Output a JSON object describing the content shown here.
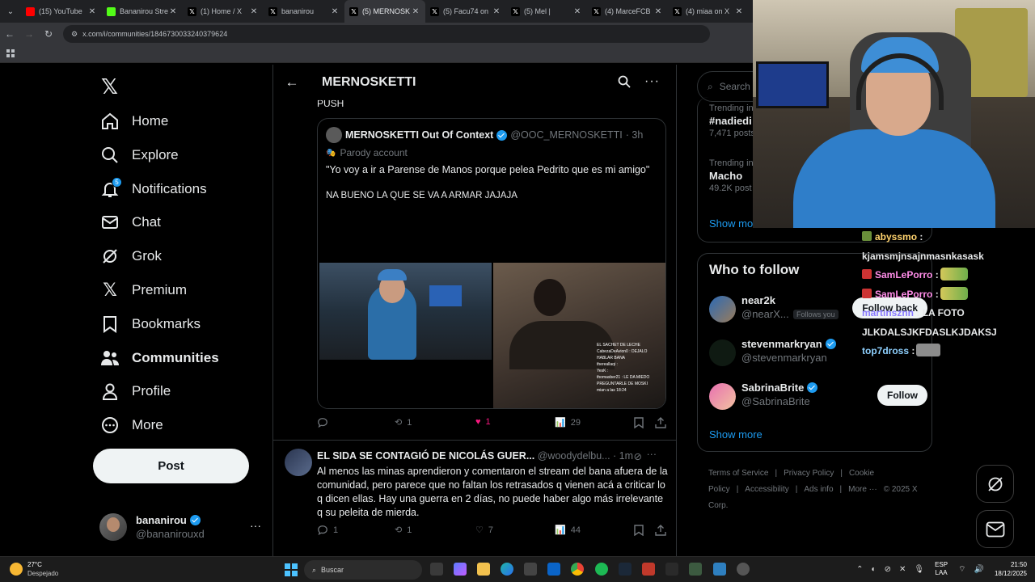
{
  "browser": {
    "tabs": [
      {
        "title": "(15) YouTube",
        "color": "#ff0000",
        "active": false
      },
      {
        "title": "Bananirou Stre",
        "color": "#53fc18",
        "active": false
      },
      {
        "title": "(1) Home / X",
        "color": "#000000",
        "active": false
      },
      {
        "title": "bananirou",
        "color": "#000000",
        "active": false
      },
      {
        "title": "(5) MERNOSK",
        "color": "#000000",
        "active": true
      },
      {
        "title": "(5) Facu74 on",
        "color": "#000000",
        "active": false
      },
      {
        "title": "(5) Mel |",
        "color": "#000000",
        "active": false
      },
      {
        "title": "(4) MarceFCB",
        "color": "#000000",
        "active": false
      },
      {
        "title": "(4) miaa on X",
        "color": "#000000",
        "active": false
      }
    ],
    "url": "x.com/i/communities/1846730033240379624"
  },
  "nav": {
    "items": [
      {
        "label": "Home",
        "icon": "home-icon"
      },
      {
        "label": "Explore",
        "icon": "search-icon"
      },
      {
        "label": "Notifications",
        "icon": "bell-icon",
        "badge": "5"
      },
      {
        "label": "Chat",
        "icon": "mail-icon"
      },
      {
        "label": "Grok",
        "icon": "grok-icon"
      },
      {
        "label": "Premium",
        "icon": "x-icon"
      },
      {
        "label": "Bookmarks",
        "icon": "bookmark-icon"
      },
      {
        "label": "Communities",
        "icon": "people-icon"
      },
      {
        "label": "Profile",
        "icon": "person-icon"
      },
      {
        "label": "More",
        "icon": "more-circle-icon"
      }
    ],
    "post_label": "Post",
    "me": {
      "name": "bananirou",
      "handle": "@bananirouxd"
    }
  },
  "main": {
    "title": "MERNOSKETTI",
    "push_text": "PUSH",
    "quote": {
      "name": "MERNOSKETTI Out Of Context",
      "handle": "@OOC_MERNOSKETTI",
      "time": "· 3h",
      "parody": "Parody account",
      "text1": "\"Yo voy a ir a Parense de Manos porque pelea Pedrito que es mi amigo\"",
      "text2": "NA BUENO LA QUE SE VA A ARMAR JAJAJA",
      "overlay_chat": [
        "EL SACHET DE LECHE",
        "CabezaDeAvion0 : DEJALO",
        "HABLAR BANA",
        "thereallaqi :",
        "YesK :",
        "thomasber21 : LE DA MIEDO",
        "PREGUNTARLE DE MOSKI",
        "mian a las 18:24"
      ]
    },
    "actions1": {
      "replies": "",
      "reposts": "1",
      "likes": "1",
      "views": "29"
    },
    "tweet2": {
      "name": "EL SIDA SE CONTAGIÓ DE NICOLÁS GUER...",
      "handle": "@woodydelbu...",
      "time": "· 1m",
      "text": "Al menos las minas aprendieron y comentaron el stream del bana afuera de la comunidad, pero parece que no faltan los retrasados q vienen acá a criticar lo q dicen ellas. Hay una guerra en 2 días, no puede haber algo más irrelevante q su peleita de mierda.",
      "replies": "1",
      "reposts": "1",
      "likes": "7",
      "views": "44"
    }
  },
  "right": {
    "search_placeholder": "Search",
    "trends": [
      {
        "context": "Trending in",
        "title": "#nadiedi",
        "posts": "7,471 posts"
      },
      {
        "context": "Trending in",
        "title": "Macho",
        "posts": "49.2K post"
      }
    ],
    "trends_show_more": "Show mo",
    "who_to_follow": {
      "title": "Who to follow",
      "users": [
        {
          "name": "near2k",
          "handle": "@nearX...",
          "follows_you": "Follows you",
          "button": "Follow back",
          "verified": false
        },
        {
          "name": "stevenmarkryan",
          "handle": "@stevenmarkryan",
          "button": "",
          "verified": true
        },
        {
          "name": "SabrinaBrite",
          "handle": "@SabrinaBrite",
          "button": "Follow",
          "verified": true
        }
      ],
      "show_more": "Show more"
    },
    "footer": [
      "Terms of Service",
      "|",
      "Privacy Policy",
      "|",
      "Cookie Policy",
      "|",
      "Accessibility",
      "|",
      "Ads info",
      "|",
      "More ···",
      "© 2025 X Corp."
    ]
  },
  "stream_chat": [
    {
      "user": "abyssmo",
      "text": ":",
      "line2": "kjamsmjnsajnmasnkasask"
    },
    {
      "user": "SamLePorro",
      "text": ":"
    },
    {
      "user": "SamLePorro",
      "text": ":"
    },
    {
      "user": "martinsznn",
      "text": ": LA FOTO",
      "line2": "JLKDALSJKFDASLKJDAKSJ"
    },
    {
      "user": "top7dross",
      "text": ":"
    }
  ],
  "taskbar": {
    "temp": "27°C",
    "weather": "Despejado",
    "search": "Buscar",
    "lang1": "ESP",
    "lang2": "LAA",
    "time": "21:50",
    "date": "18/12/2025"
  }
}
